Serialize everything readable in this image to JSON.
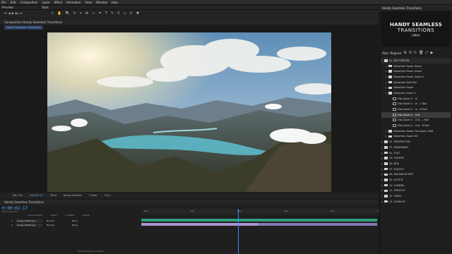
{
  "menu": [
    "File",
    "Edit",
    "Composition",
    "Layer",
    "Effect",
    "Animation",
    "View",
    "Window",
    "Help"
  ],
  "preview_title": "Preview",
  "tools_title": "Tools",
  "comp_tab": "Composition Handy Seamless Transitions",
  "comp_subtab": "Handy Seamless Transitions",
  "comp_controls": {
    "zoom": "(61,7%)",
    "time": "0:00:02:17",
    "res": "Third",
    "camera": "Active Camera",
    "view": "1 View",
    "offset": "+0,0"
  },
  "timeline_title": "Handy Seamless Transitions",
  "timecode": "0:00:02:17",
  "fps": "00071 (25.00 fps)",
  "columns": [
    "Source Name",
    "Mode",
    "T TrkMat",
    "Parent"
  ],
  "layers": [
    {
      "num": "1",
      "name": "Image_00002.jpg",
      "mode": "Normal",
      "parent": "None"
    },
    {
      "num": "2",
      "name": "Image_00003.jpg",
      "mode": "Normal",
      "parent": "None"
    }
  ],
  "ruler": [
    "00s",
    "02s",
    "04s",
    "06s",
    "08s",
    "10s"
  ],
  "toggle": "Toggle Switches / Modes",
  "side_title": "Handy Seamless Transitions",
  "logo": {
    "l1": "HANDY SEAMLESS",
    "l2": "TRANSITIONS",
    "l3": "v3.2"
  },
  "add_replace": "Add / Replace",
  "tree": [
    {
      "t": "01. DISTORTION",
      "type": "folder",
      "lvl": 0,
      "open": true,
      "cls": "hi"
    },
    {
      "t": "Distortion Hyper Zoom",
      "type": "folder",
      "lvl": 1
    },
    {
      "t": "Distortion Power Zoom",
      "type": "folder",
      "lvl": 1
    },
    {
      "t": "Distortion Power Zoom 2",
      "type": "folder",
      "lvl": 1
    },
    {
      "t": "Distortion Side Roll",
      "type": "folder",
      "lvl": 1
    },
    {
      "t": "Distortion Zoom",
      "type": "folder",
      "lvl": 1
    },
    {
      "t": "Distortion Zoom 2",
      "type": "folder",
      "lvl": 1,
      "open": true
    },
    {
      "t": "Dist Zoom 2 - In",
      "type": "preset",
      "lvl": 2
    },
    {
      "t": "Dist Zoom 2 - In - L Roll",
      "type": "preset",
      "lvl": 2
    },
    {
      "t": "Dist Zoom 2 - In - R Roll",
      "type": "preset",
      "lvl": 2
    },
    {
      "t": "Dist Zoom 2 - Out",
      "type": "preset",
      "lvl": 2,
      "cls": "sel"
    },
    {
      "t": "Dist Zoom 2 - Out - L Roll",
      "type": "preset",
      "lvl": 2
    },
    {
      "t": "Dist Zoom 2 - Out - R Roll",
      "type": "preset",
      "lvl": 2
    },
    {
      "t": "Distortion Zoom Chromatic Shift",
      "type": "folder",
      "lvl": 1
    },
    {
      "t": "Distortion Zoom Hit",
      "type": "folder",
      "lvl": 1
    },
    {
      "t": "02. PERSPECTIVE",
      "type": "folder",
      "lvl": 0
    },
    {
      "t": "03. PANORAMIC",
      "type": "folder",
      "lvl": 0
    },
    {
      "t": "04. FLAT",
      "type": "folder",
      "lvl": 0
    },
    {
      "t": "05. FISHEYE",
      "type": "folder",
      "lvl": 0
    },
    {
      "t": "06. BOX",
      "type": "folder",
      "lvl": 0
    },
    {
      "t": "07. ELASTIC",
      "type": "folder",
      "lvl": 0
    },
    {
      "t": "08. KALEIDOSCOPE",
      "type": "folder",
      "lvl": 0
    },
    {
      "t": "09. GLITCH",
      "type": "folder",
      "lvl": 0
    },
    {
      "t": "10. CAMERA",
      "type": "folder",
      "lvl": 0
    },
    {
      "t": "11. STRETCH",
      "type": "folder",
      "lvl": 0
    },
    {
      "t": "12. TWIRL",
      "type": "folder",
      "lvl": 0
    },
    {
      "t": "13. OVERLAY",
      "type": "folder",
      "lvl": 0
    }
  ]
}
